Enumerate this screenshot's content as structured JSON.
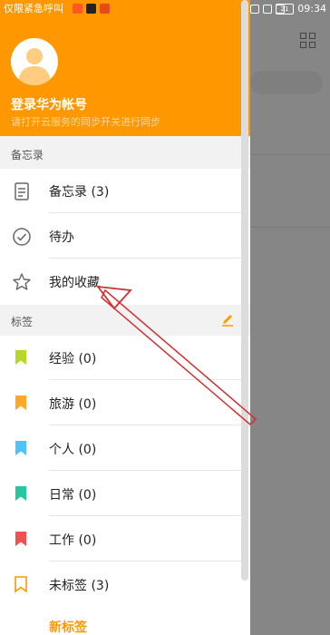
{
  "status": {
    "carrier": "仅限紧急呼叫",
    "time": "09:34",
    "battery": "21"
  },
  "header": {
    "login_title": "登录华为帐号",
    "login_subtitle": "请打开云服务的同步开关进行同步"
  },
  "sections": {
    "notes_label": "备忘录",
    "tags_label": "标签"
  },
  "notes_items": [
    {
      "label": "备忘录 (3)",
      "icon": "note-icon"
    },
    {
      "label": "待办",
      "icon": "check-circle-icon"
    },
    {
      "label": "我的收藏",
      "icon": "star-icon"
    }
  ],
  "tag_items": [
    {
      "label": "经验 (0)",
      "color": "#b8d62a"
    },
    {
      "label": "旅游 (0)",
      "color": "#ffa726"
    },
    {
      "label": "个人 (0)",
      "color": "#4fc3f7"
    },
    {
      "label": "日常 (0)",
      "color": "#26c6a0"
    },
    {
      "label": "工作 (0)",
      "color": "#ef5350"
    },
    {
      "label": "未标签 (3)",
      "color": "#ff9800"
    }
  ],
  "new_tag_label": "新标签",
  "colors": {
    "accent": "#ff9800",
    "arrow": "#d32f2f"
  }
}
